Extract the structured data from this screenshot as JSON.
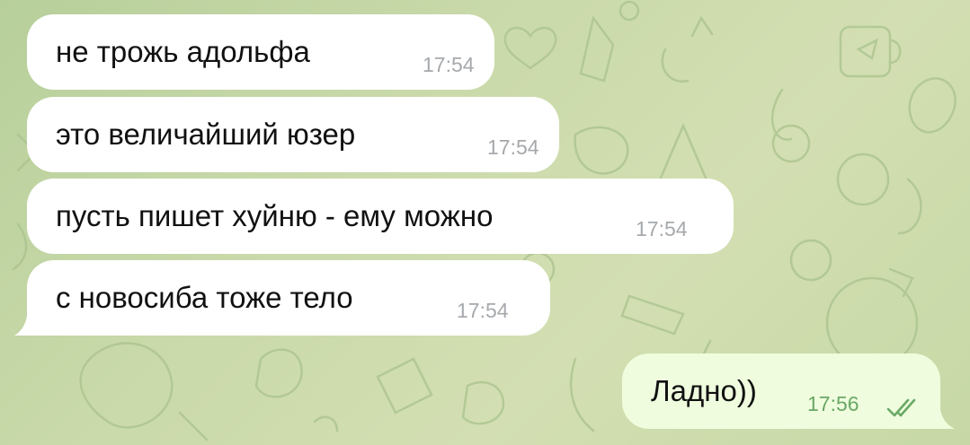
{
  "colors": {
    "incoming_bubble": "#ffffff",
    "outgoing_bubble": "#effdde",
    "incoming_time": "#a6a9ac",
    "outgoing_time": "#6aa866",
    "text": "#111111",
    "background": "#c9d9a9"
  },
  "messages": [
    {
      "direction": "incoming",
      "text": "не трожь адольфа",
      "time": "17:54"
    },
    {
      "direction": "incoming",
      "text": "это величайший юзер",
      "time": "17:54"
    },
    {
      "direction": "incoming",
      "text": "пусть пишет хуйню - ему можно",
      "time": "17:54"
    },
    {
      "direction": "incoming",
      "text": "с новосиба тоже тело",
      "time": "17:54"
    },
    {
      "direction": "outgoing",
      "text": "Ладно))",
      "time": "17:56",
      "status_icon": "double-check-icon",
      "status": "read"
    }
  ]
}
